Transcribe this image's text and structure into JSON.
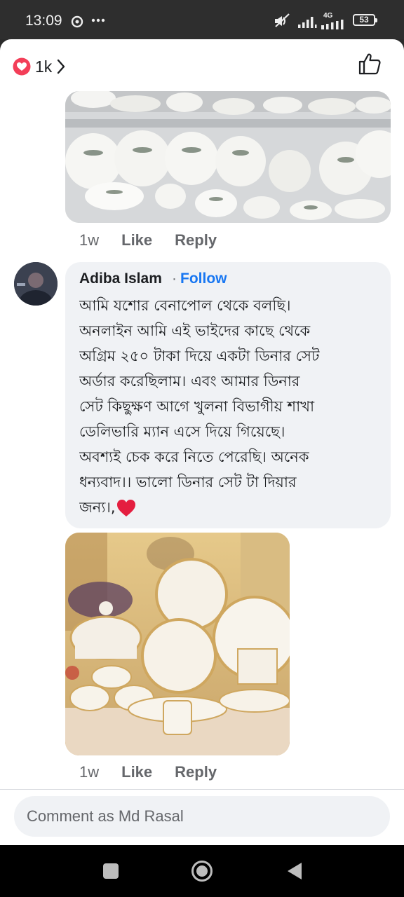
{
  "status_bar": {
    "time": "13:09",
    "network": "4G",
    "battery": "53"
  },
  "reactions": {
    "count": "1k"
  },
  "comments": [
    {
      "time": "1w",
      "like_label": "Like",
      "reply_label": "Reply"
    },
    {
      "author": "Adiba Islam",
      "separator": "·",
      "follow_label": "Follow",
      "lines": [
        "আমি যশোর বেনাপোল থেকে বলছি।",
        "অনলাইন আমি এই ভাইদের কাছে  থেকে",
        "অগ্রিম ২৫০ টাকা দিয়ে একটা ডিনার সেট",
        "অর্ডার করেছিলাম। এবং আমার ডিনার",
        "সেট  কিছুক্ষণ আগে খুলনা বিভাগীয় শাখা",
        "ডেলিভারি ম্যান এসে  দিয়ে গিয়েছে।",
        "অবশ্যই  চেক করে নিতে পেরেছি। অনেক",
        "ধন্যবাদ।। ভালো  ডিনার সেট  টা দিয়ার",
        "জন্য।,"
      ],
      "time": "1w",
      "like_label": "Like",
      "reply_label": "Reply"
    }
  ],
  "composer": {
    "placeholder": "Comment as Md Rasal"
  },
  "colors": {
    "accent": "#1877f2",
    "heart": "#e41e3f",
    "bubble": "#f0f2f5",
    "muted": "#65676b"
  },
  "icons": [
    "heart-icon",
    "chevron-right-icon",
    "thumbs-up-icon",
    "back-icon",
    "home-icon",
    "recents-icon"
  ]
}
